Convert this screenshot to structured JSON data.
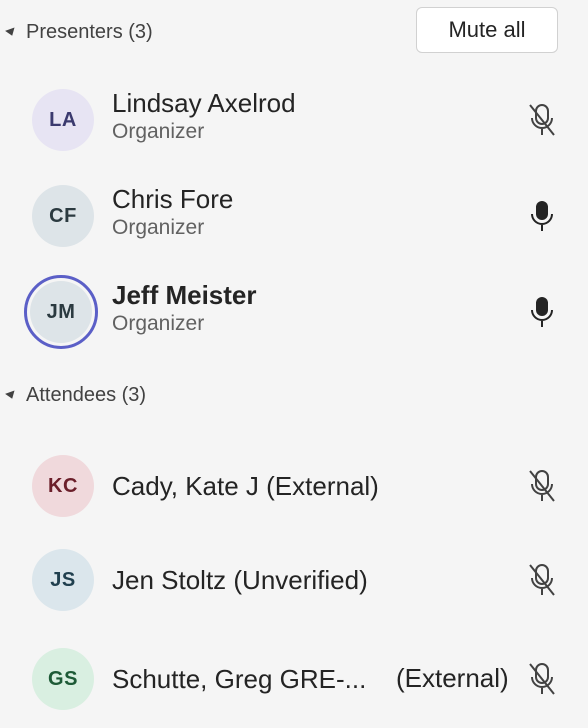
{
  "presenters": {
    "header": "Presenters (3)",
    "mute_all_label": "Mute all",
    "people": [
      {
        "initials": "LA",
        "name": "Lindsay Axelrod",
        "role": "Organizer",
        "muted": true,
        "avatar_bg": "#e7e4f3",
        "avatar_fg": "#3b3a6e"
      },
      {
        "initials": "CF",
        "name": "Chris Fore",
        "role": "Organizer",
        "muted": false,
        "avatar_bg": "#dde4e8",
        "avatar_fg": "#2b3a40"
      },
      {
        "initials": "JM",
        "name": "Jeff Meister",
        "role": "Organizer",
        "muted": false,
        "speaking": true,
        "avatar_bg": "#dde4e8",
        "avatar_fg": "#2b3a40"
      }
    ]
  },
  "attendees": {
    "header": "Attendees (3)",
    "people": [
      {
        "initials": "KC",
        "name": "Cady, Kate J (External)",
        "muted": true,
        "avatar_bg": "#f0d9dc",
        "avatar_fg": "#6b1f2a"
      },
      {
        "initials": "JS",
        "name": "Jen Stoltz (Unverified)",
        "muted": true,
        "avatar_bg": "#dbe6ec",
        "avatar_fg": "#21404f"
      },
      {
        "initials": "GS",
        "name": "Schutte, Greg GRE-...",
        "suffix": "(External)",
        "muted": true,
        "avatar_bg": "#d9efe1",
        "avatar_fg": "#1d5a36"
      }
    ]
  },
  "icons": {
    "mic_on": "microphone-icon",
    "mic_off": "microphone-off-icon",
    "caret": "caret-down-icon"
  },
  "colors": {
    "speaking_ring": "#5b5fc7",
    "background": "#f5f5f5"
  }
}
